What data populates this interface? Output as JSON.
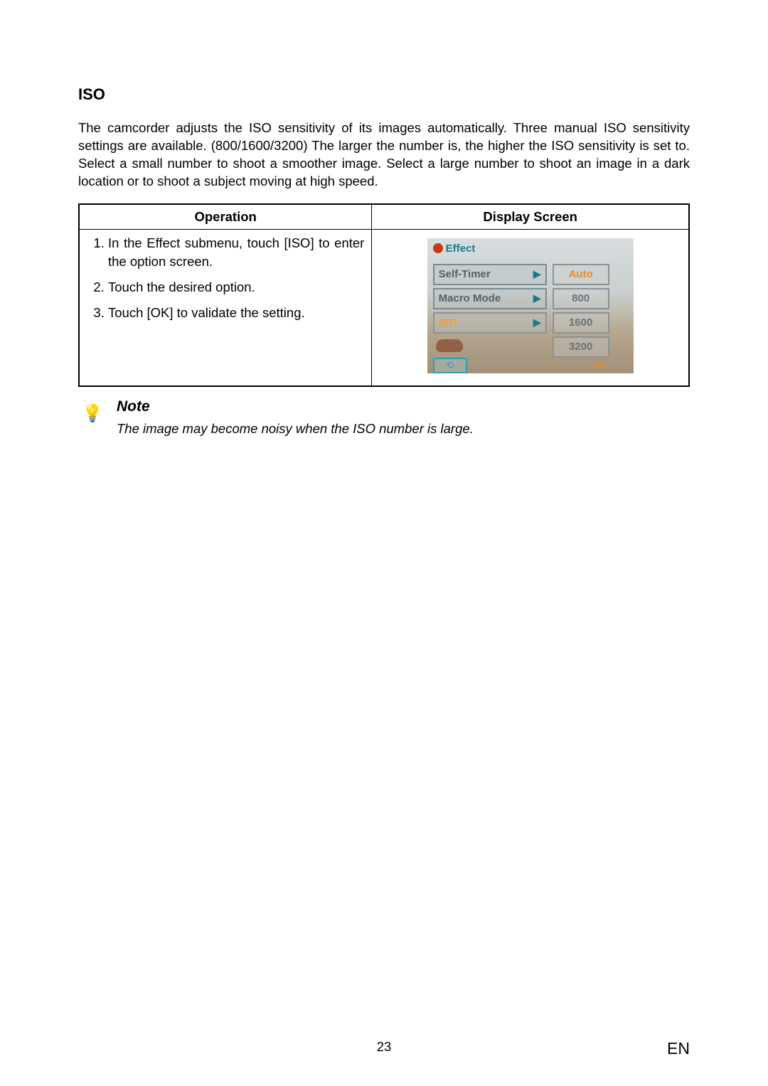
{
  "section": {
    "title": "ISO",
    "paragraph": "The camcorder adjusts the ISO sensitivity of its images automatically. Three manual ISO sensitivity settings are available. (800/1600/3200) The larger the number is, the higher the ISO sensitivity is set to. Select a small number to shoot a smoother image.  Select a large number to shoot an image in a dark location or to shoot a subject moving at high speed."
  },
  "table": {
    "headers": {
      "operation": "Operation",
      "display": "Display Screen"
    },
    "steps": [
      "In the Effect submenu, touch [ISO] to enter the option screen.",
      "Touch the desired option.",
      "Touch [OK] to validate the setting."
    ]
  },
  "display_screen": {
    "header": "Effect",
    "menu_items": {
      "self_timer": "Self-Timer",
      "macro_mode": "Macro Mode",
      "iso": "ISO"
    },
    "values": {
      "auto": "Auto",
      "v800": "800",
      "v1600": "1600",
      "v3200": "3200"
    },
    "ok": "OK",
    "back": "⟲"
  },
  "note": {
    "heading": "Note",
    "body": "The image may become noisy when the ISO number is large."
  },
  "footer": {
    "page": "23",
    "lang": "EN"
  }
}
